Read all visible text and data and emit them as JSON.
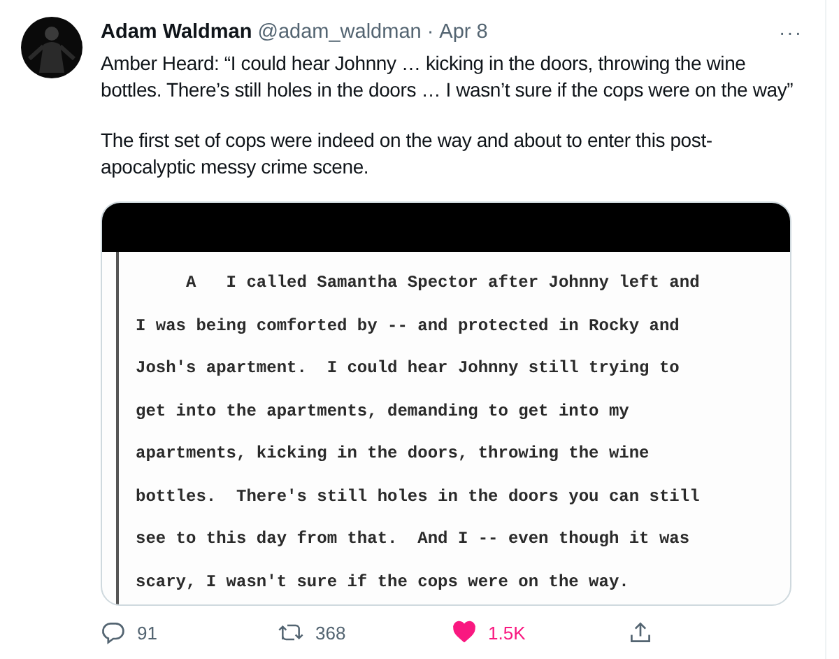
{
  "tweet": {
    "name": "Adam Waldman",
    "handle": "@adam_waldman",
    "separator": "·",
    "date": "Apr 8",
    "more": "···",
    "paragraphs": [
      "Amber Heard: “I could hear Johnny … kicking in the doors, throwing the wine bottles. There’s still holes in the doors … I wasn’t sure if the cops were on the way”",
      "The first set of cops were indeed on the way and about to enter this post-apocalyptic messy crime scene."
    ],
    "document_lines": [
      "     A   I called Samantha Spector after Johnny left and",
      "I was being comforted by -- and protected in Rocky and",
      "Josh's apartment.  I could hear Johnny still trying to",
      "get into the apartments, demanding to get into my",
      "apartments, kicking in the doors, throwing the wine",
      "bottles.  There's still holes in the doors you can still",
      "see to this day from that.  And I -- even though it was",
      "scary, I wasn't sure if the cops were on the way."
    ],
    "actions": {
      "replies": "91",
      "retweets": "368",
      "likes": "1.5K",
      "liked": true
    }
  }
}
